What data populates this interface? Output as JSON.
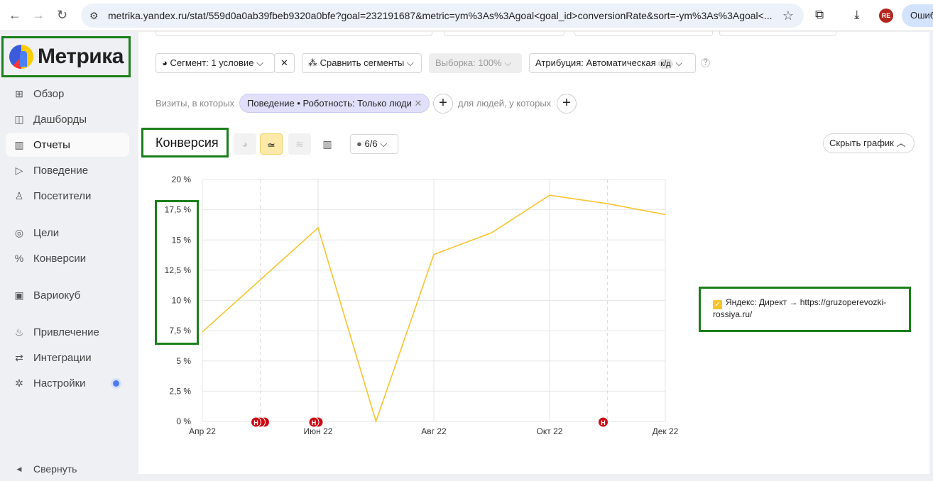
{
  "browser": {
    "url": "metrika.yandex.ru/stat/559d0a0ab39fbeb9320a0bfe?goal=232191687&metric=ym%3As%3Agoal<goal_id>conversionRate&sort=-ym%3As%3Agoal<...",
    "avatar": "RE",
    "error_button": "Ошиб"
  },
  "sidebar": {
    "logo": "Метрика",
    "items": [
      {
        "label": "Обзор",
        "icon": "⊞"
      },
      {
        "label": "Дашборды",
        "icon": "◫"
      },
      {
        "label": "Отчеты",
        "icon": "▥"
      },
      {
        "label": "Поведение",
        "icon": "▷"
      },
      {
        "label": "Посетители",
        "icon": "♙"
      },
      {
        "label": "Цели",
        "icon": "◎"
      },
      {
        "label": "Конверсии",
        "icon": "%"
      },
      {
        "label": "Вариокуб",
        "icon": "▣"
      },
      {
        "label": "Привлечение",
        "icon": "♨"
      },
      {
        "label": "Интеграции",
        "icon": "⇄"
      },
      {
        "label": "Настройки",
        "icon": "✲"
      }
    ],
    "collapse": "Свернуть"
  },
  "toolbar": {
    "segment": "Сегмент: 1 условие",
    "compare": "Сравнить сегменты",
    "sample": "Выборка: 100%",
    "attribution": "Атрибуция: Автоматическая",
    "attribution_badge": "к/д"
  },
  "filter": {
    "prefix": "Визиты, в которых",
    "chip": "Поведение • Роботность: Только люди",
    "suffix": "для людей, у которых"
  },
  "report": {
    "title": "Конверсия",
    "annotations_count": "6/6",
    "hide_chart": "Скрыть график"
  },
  "legend": {
    "label": "Яндекс: Директ → https://gruzoperevozki-rossiya.ru/"
  },
  "colors": {
    "line": "#f7c32e",
    "marker": "#cc0a14",
    "frame": "#1a7f1a"
  },
  "chart_data": {
    "type": "line",
    "xlabels": [
      "Апр 22",
      "Июн 22",
      "Авг 22",
      "Окт 22",
      "Дек 22"
    ],
    "x": [
      "2022-04",
      "2022-05",
      "2022-06",
      "2022-07",
      "2022-08",
      "2022-09",
      "2022-10",
      "2022-11",
      "2022-12"
    ],
    "series": [
      {
        "name": "Яндекс: Директ → https://gruzoperevozki-rossiya.ru/",
        "values": [
          7.4,
          11.7,
          16.0,
          0,
          13.8,
          15.6,
          18.7,
          18.0,
          17.1
        ]
      }
    ],
    "yticks": [
      "0 %",
      "2,5 %",
      "5 %",
      "7,5 %",
      "10 %",
      "12,5 %",
      "15 %",
      "17,5 %",
      "20 %"
    ],
    "ylim": [
      0,
      20
    ],
    "annotations": [
      {
        "month": 1.0,
        "count": 3,
        "label": "Н"
      },
      {
        "month": 2.0,
        "count": 2,
        "label": "Н"
      },
      {
        "month": 7.0,
        "count": 1,
        "label": "Н"
      }
    ]
  }
}
